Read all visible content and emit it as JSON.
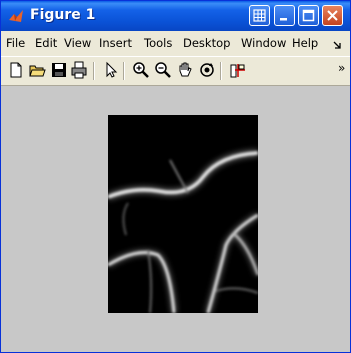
{
  "window": {
    "title": "Figure 1"
  },
  "menu": [
    "File",
    "Edit",
    "View",
    "Insert",
    "Tools",
    "Desktop",
    "Window",
    "Help"
  ],
  "menu_overflow_icon": "arrow-icon",
  "toolbar": {
    "tools": [
      "new-icon",
      "open-icon",
      "save-icon",
      "print-icon",
      "pointer-icon",
      "zoom-in-icon",
      "zoom-out-icon",
      "pan-icon",
      "rotate-icon",
      "data-cursor-icon"
    ],
    "overflow": "»"
  },
  "colors": {
    "titlebar": "#0a52d6",
    "figure_bg": "#c8c8c8",
    "image_bg": "#000000"
  }
}
